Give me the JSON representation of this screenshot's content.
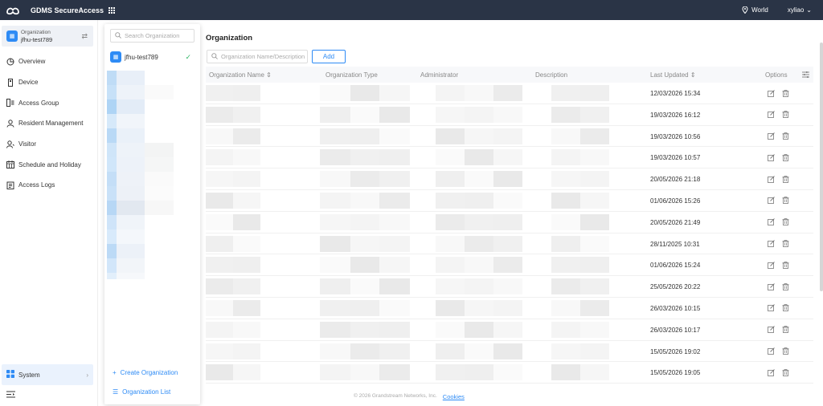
{
  "topbar": {
    "app_title": "GDMS SecureAccess",
    "region": "World",
    "user": "xyliao"
  },
  "sidebar": {
    "org_caption": "Organization",
    "org_name": "jfhu-test789",
    "items": [
      {
        "label": "Overview",
        "icon": "overview-icon"
      },
      {
        "label": "Device",
        "icon": "device-icon"
      },
      {
        "label": "Access Group",
        "icon": "access-group-icon"
      },
      {
        "label": "Resident Management",
        "icon": "resident-icon"
      },
      {
        "label": "Visitor",
        "icon": "visitor-icon"
      },
      {
        "label": "Schedule and Holiday",
        "icon": "calendar-icon"
      },
      {
        "label": "Access Logs",
        "icon": "logs-icon"
      }
    ],
    "system_label": "System"
  },
  "org_panel": {
    "search_placeholder": "Search Organization",
    "selected_org": "jfhu-test789",
    "create_label": "Create Organization",
    "list_label": "Organization List"
  },
  "main": {
    "title": "Organization",
    "search_placeholder": "Organization Name/Description",
    "add_label": "Add",
    "columns": {
      "name": "Organization Name",
      "type": "Organization Type",
      "admin": "Administrator",
      "desc": "Description",
      "updated": "Last Updated",
      "options": "Options"
    },
    "rows": [
      {
        "updated": "12/03/2026 15:34"
      },
      {
        "updated": "19/03/2026 16:12"
      },
      {
        "updated": "19/03/2026 10:56"
      },
      {
        "updated": "19/03/2026 10:57"
      },
      {
        "updated": "20/05/2026 21:18"
      },
      {
        "updated": "01/06/2026 15:26"
      },
      {
        "updated": "20/05/2026 21:49"
      },
      {
        "updated": "28/11/2025 10:31"
      },
      {
        "updated": "01/06/2026 15:24"
      },
      {
        "updated": "25/05/2026 20:22"
      },
      {
        "updated": "26/03/2026 10:15"
      },
      {
        "updated": "26/03/2026 10:17"
      },
      {
        "updated": "15/05/2026 19:02"
      },
      {
        "updated": "15/05/2026 19:05"
      }
    ]
  },
  "footer": {
    "copyright": "© 2026 Grandstream Networks, Inc.",
    "cookies": "Cookies"
  },
  "colors": {
    "topbar_bg": "#2a3446",
    "accent": "#2e8bf5",
    "check": "#35b86a"
  }
}
